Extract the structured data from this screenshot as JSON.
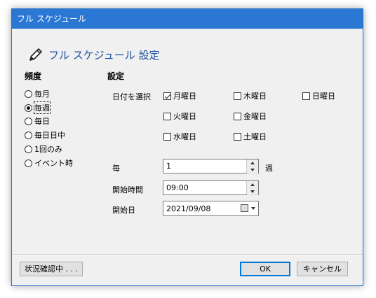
{
  "window": {
    "title": "フル スケジュール"
  },
  "heading": {
    "text": "フル スケジュール 設定",
    "icon": "pencil-icon"
  },
  "frequency": {
    "title": "頻度",
    "options": [
      {
        "label": "毎月",
        "checked": false
      },
      {
        "label": "毎週",
        "checked": true
      },
      {
        "label": "毎日",
        "checked": false
      },
      {
        "label": "毎日日中",
        "checked": false
      },
      {
        "label": "1回のみ",
        "checked": false
      },
      {
        "label": "イベント時",
        "checked": false
      }
    ]
  },
  "settings": {
    "title": "設定",
    "day_select_label": "日付を選択",
    "days": [
      {
        "label": "月曜日",
        "checked": true
      },
      {
        "label": "火曜日",
        "checked": false
      },
      {
        "label": "水曜日",
        "checked": false
      },
      {
        "label": "木曜日",
        "checked": false
      },
      {
        "label": "金曜日",
        "checked": false
      },
      {
        "label": "土曜日",
        "checked": false
      },
      {
        "label": "日曜日",
        "checked": false
      }
    ],
    "every_label": "毎",
    "every_value": "1",
    "every_unit": "週",
    "start_time_label": "開始時間",
    "start_time_value": "09:00",
    "start_date_label": "開始日",
    "start_date_value": "2021/09/08"
  },
  "footer": {
    "status_button": "状況確認中 . . .",
    "ok_button": "OK",
    "cancel_button": "キャンセル"
  },
  "colors": {
    "titlebar": "#2b78d4",
    "heading_text": "#1e50a0",
    "window_bg": "#f0f0f0"
  }
}
